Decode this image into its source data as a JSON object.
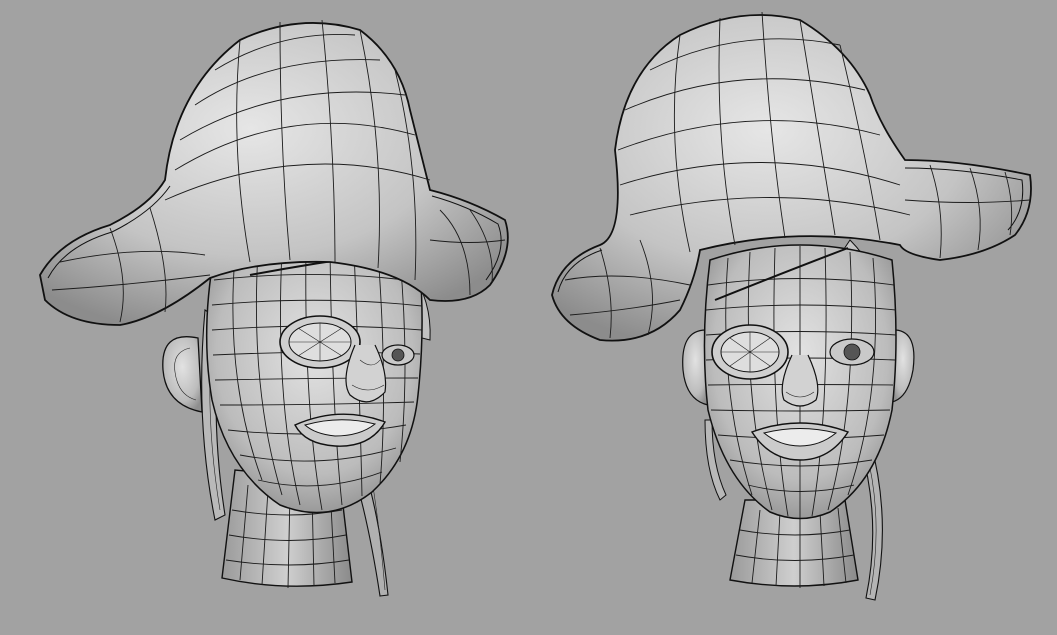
{
  "viewport": {
    "background": "#a2a2a2",
    "shading_colors": {
      "light": "#dcdcdc",
      "mid": "#bdbdbd",
      "dark": "#8a8a8a",
      "wire": "#1c1c1c"
    }
  },
  "models": [
    {
      "view": "three-quarter",
      "subject": "pirate-head",
      "features": [
        "tricorn-hat",
        "eye-patch",
        "ponytail-hair"
      ]
    },
    {
      "view": "front",
      "subject": "pirate-head",
      "features": [
        "tricorn-hat",
        "eye-patch",
        "ponytail-hair"
      ]
    }
  ]
}
